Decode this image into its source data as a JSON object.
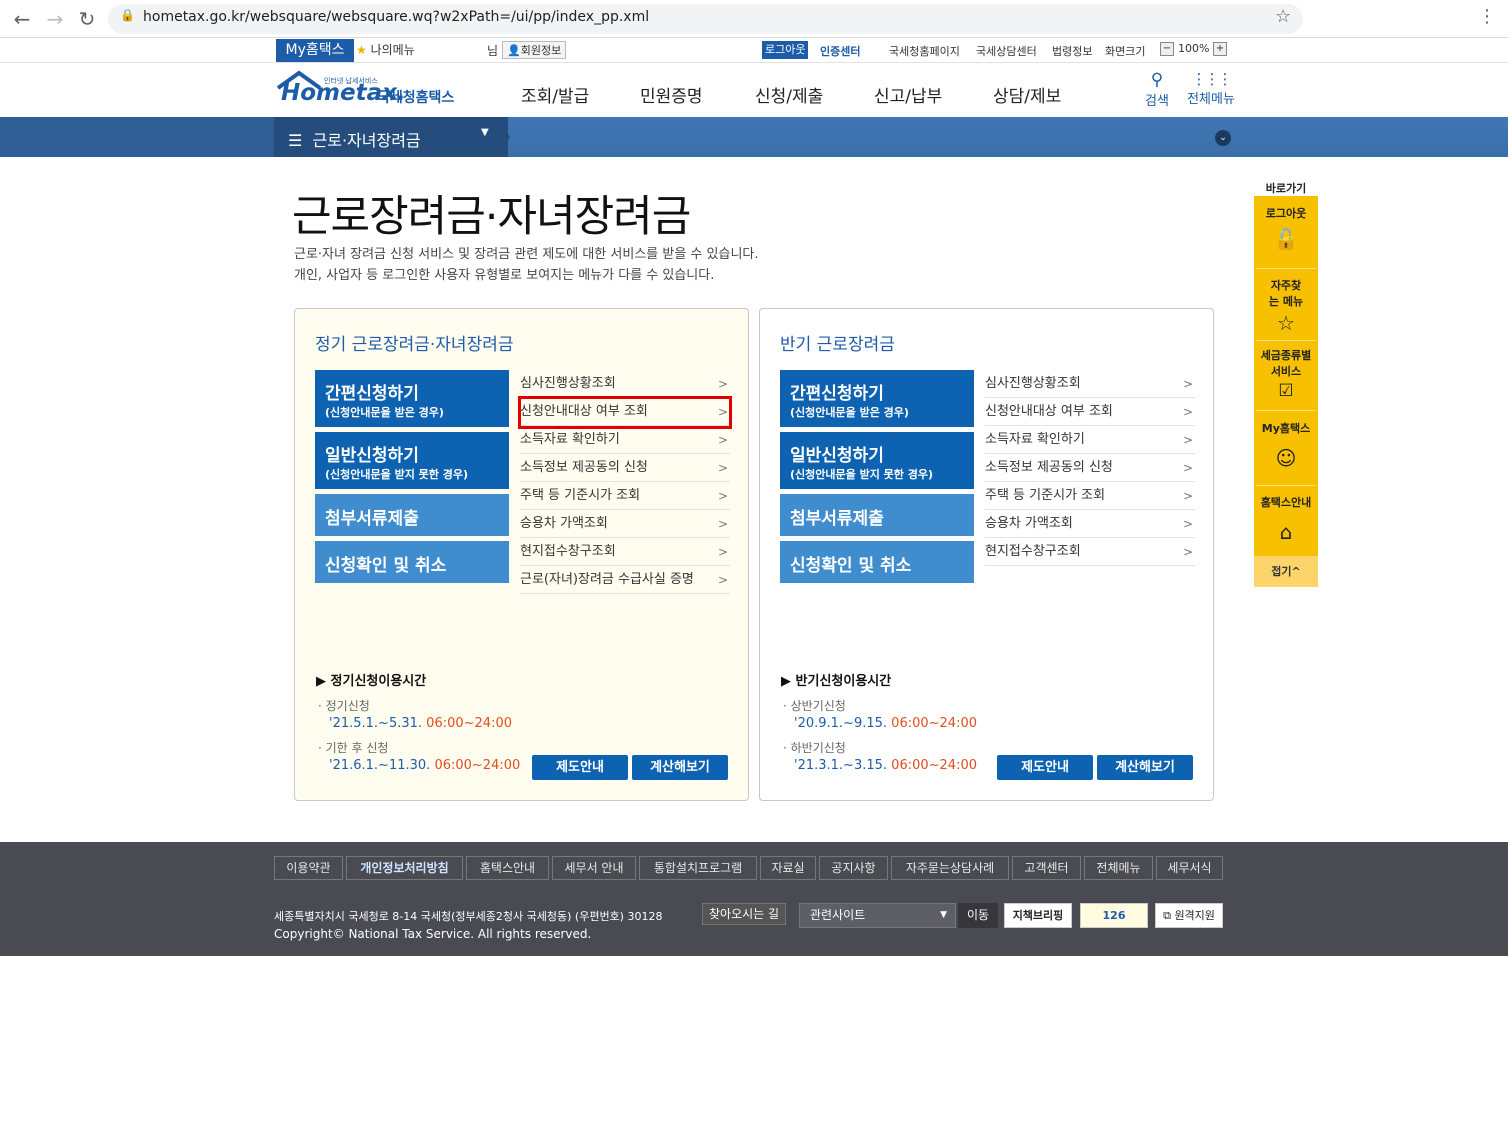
{
  "browser": {
    "url": "hometax.go.kr/websquare/websquare.wq?w2xPath=/ui/pp/index_pp.xml",
    "back_icon": "back-arrow-icon",
    "forward_icon": "forward-arrow-icon",
    "reload_icon": "reload-icon"
  },
  "util": {
    "my_hometax": "My홈택스",
    "my_menu": "나의메뉴",
    "nim": "님",
    "member_info": "회원정보",
    "logout": "로그아웃",
    "cert_center": "인증센터",
    "links": [
      "국세청홈페이지",
      "국세상담센터",
      "법령정보",
      "화면크기"
    ],
    "zoom_minus": "−",
    "zoom": "100%",
    "zoom_plus": "+"
  },
  "header": {
    "logo_sub": "인터넷 납세서비스",
    "logo": "Hometax.",
    "logo_kor": "국세청홈택스",
    "gnb": [
      "조회/발급",
      "민원증명",
      "신청/제출",
      "신고/납부",
      "상담/제보"
    ],
    "search": "검색",
    "all_menu": "전체메뉴"
  },
  "band": {
    "selected": "근로·자녀장려금"
  },
  "page": {
    "title": "근로장려금·자녀장려금",
    "desc1": "근로·자녀 장려금 신청 서비스 및 장려금 관련 제도에 대한 서비스를 받을 수 있습니다.",
    "desc2": "개인, 사업자 등 로그인한 사용자 유형별로 보여지는 메뉴가 다를 수 있습니다."
  },
  "left": {
    "title": "정기 근로장려금·자녀장려금",
    "buttons": [
      {
        "title": "간편신청하기",
        "sub": "(신청안내문을 받은 경우)"
      },
      {
        "title": "일반신청하기",
        "sub": "(신청안내문을 받지 못한 경우)"
      },
      {
        "title": "첨부서류제출"
      },
      {
        "title": "신청확인 및 취소"
      }
    ],
    "links": [
      "심사진행상황조회",
      "신청안내대상 여부 조회",
      "소득자료 확인하기",
      "소득정보 제공동의 신청",
      "주택 등 기준시가 조회",
      "승용차 가액조회",
      "현지접수창구조회",
      "근로(자녀)장려금 수급사실 증명"
    ],
    "section": "정기신청이용시간",
    "period1_label": "정기신청",
    "period1_date": "'21.5.1.~5.31.",
    "period1_time": "06:00~24:00",
    "period2_label": "기한 후 신청",
    "period2_date": "'21.6.1.~11.30.",
    "period2_time": "06:00~24:00",
    "btn_guide": "제도안내",
    "btn_calc": "계산해보기"
  },
  "right": {
    "title": "반기 근로장려금",
    "buttons": [
      {
        "title": "간편신청하기",
        "sub": "(신청안내문을 받은 경우)"
      },
      {
        "title": "일반신청하기",
        "sub": "(신청안내문을 받지 못한 경우)"
      },
      {
        "title": "첨부서류제출"
      },
      {
        "title": "신청확인 및 취소"
      }
    ],
    "links": [
      "심사진행상황조회",
      "신청안내대상 여부 조회",
      "소득자료 확인하기",
      "소득정보 제공동의 신청",
      "주택 등 기준시가 조회",
      "승용차 가액조회",
      "현지접수창구조회"
    ],
    "section": "반기신청이용시간",
    "period1_label": "상반기신청",
    "period1_date": "'20.9.1.~9.15.",
    "period1_time": "06:00~24:00",
    "period2_label": "하반기신청",
    "period2_date": "'21.3.1.~3.15.",
    "period2_time": "06:00~24:00",
    "btn_guide": "제도안내",
    "btn_calc": "계산해보기"
  },
  "quick": {
    "title": "바로가기",
    "items": [
      {
        "label": "로그아웃",
        "icon": "padlock-icon"
      },
      {
        "label": "자주찾는 메뉴",
        "icon": "star-icon"
      },
      {
        "label": "세금종류별 서비스",
        "icon": "checkbox-icon"
      },
      {
        "label": "My홈택스",
        "icon": "person-icon"
      },
      {
        "label": "홈택스안내",
        "icon": "house-icon"
      }
    ],
    "fold": "접기^"
  },
  "footer": {
    "links": [
      "이용약관",
      "개인정보처리방침",
      "홈택스안내",
      "세무서 안내",
      "통합설치프로그램",
      "자료실",
      "공지사항",
      "자주묻는상담사례",
      "고객센터",
      "전체메뉴",
      "세무서식"
    ],
    "address": "세종특별자치시 국세청로 8-14 국세청(정부세종2청사 국세청동) (우편번호) 30128",
    "find_road": "찾아오시는 길",
    "copyright": "Copyright© National Tax Service. All rights reserved.",
    "related": "관련사이트",
    "move": "이동",
    "btn1": "지책브리핑",
    "btn2": "126",
    "btn3": "원격지원"
  },
  "colors": {
    "brand_blue": "#1d5ca8",
    "band": "#2e5e95",
    "button_dark": "#0d62b1",
    "button_light": "#3f8ccf",
    "quick_yellow": "#f7c000",
    "highlight_red": "#e20000",
    "time_orange": "#e04e1e",
    "footer": "#4a4a52"
  }
}
